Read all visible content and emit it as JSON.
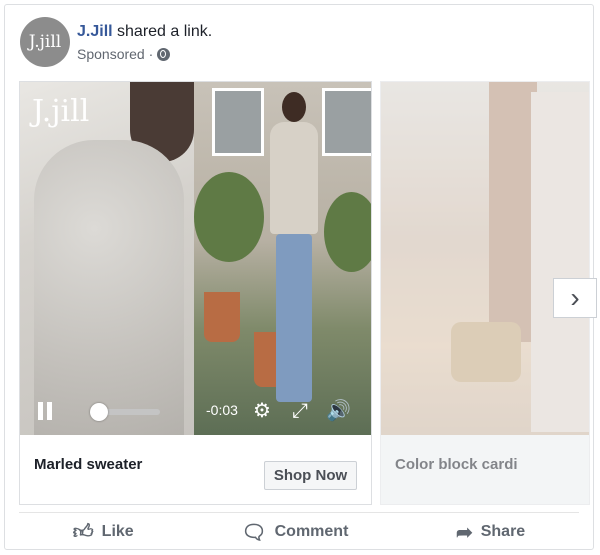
{
  "post": {
    "page_name": "J.Jill",
    "action_text": "shared a link.",
    "sponsored": "Sponsored · ",
    "avatar_text": "J.jill"
  },
  "carousel": {
    "cards": [
      {
        "logo_text": "J.jill",
        "time": "-0:03",
        "title": "Marled sweater",
        "cta": "Shop Now"
      },
      {
        "title": "Color block cardi"
      }
    ],
    "next_arrow": "›"
  },
  "actions": {
    "like": "Like",
    "comment": "Comment",
    "share": "Share"
  },
  "icons": {
    "pause": "pause-icon",
    "settings": "gear-icon",
    "fullscreen": "fullscreen-icon",
    "volume": "volume-icon",
    "globe": "globe-icon"
  },
  "colors": {
    "brand_link": "#365899",
    "muted_text": "#616770"
  }
}
